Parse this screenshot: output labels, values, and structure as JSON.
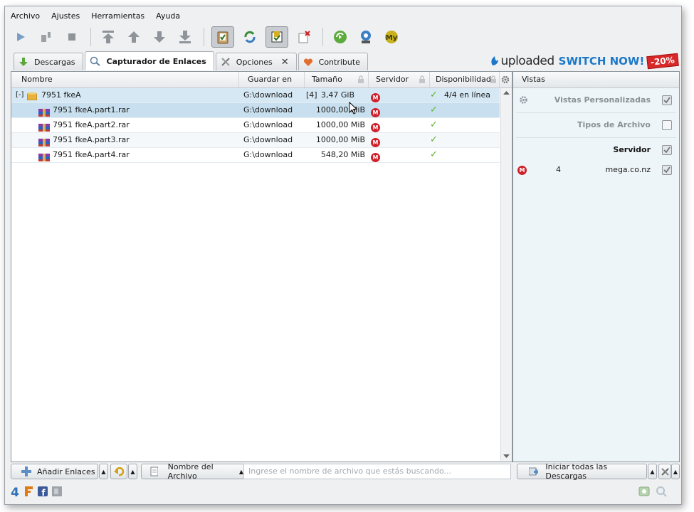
{
  "menu": [
    "Archivo",
    "Ajustes",
    "Herramientas",
    "Ayuda"
  ],
  "tabs": [
    {
      "label": "Descargas"
    },
    {
      "label": "Capturador de Enlaces"
    },
    {
      "label": "Opciones"
    },
    {
      "label": "Contribute"
    }
  ],
  "ad": {
    "brand": "uploaded",
    "cta": "SWITCH NOW!",
    "discount": "-20%"
  },
  "columns": {
    "name": "Nombre",
    "save_to": "Guardar en",
    "size": "Tamaño",
    "host": "Servidor",
    "availability": "Disponibilidad"
  },
  "package": {
    "expander": "[-]",
    "name": "7951 fkeA",
    "save_to": "G:\\download",
    "count": "[4]",
    "size": "3,47 GiB",
    "availability": "4/4 en línea"
  },
  "files": [
    {
      "name": "7951 fkeA.part1.rar",
      "save_to": "G:\\download",
      "size": "1000,00 MiB"
    },
    {
      "name": "7951 fkeA.part2.rar",
      "save_to": "G:\\download",
      "size": "1000,00 MiB"
    },
    {
      "name": "7951 fkeA.part3.rar",
      "save_to": "G:\\download",
      "size": "1000,00 MiB"
    },
    {
      "name": "7951 fkeA.part4.rar",
      "save_to": "G:\\download",
      "size": "548,20 MiB"
    }
  ],
  "host_badge": "M",
  "views": {
    "title": "Vistas",
    "custom": "Vistas Personalizadas",
    "file_types": "Tipos de Archivo",
    "host": "Servidor",
    "host_entry": {
      "count": "4",
      "name": "mega.co.nz"
    }
  },
  "bottom": {
    "add_links": "Añadir Enlaces",
    "filename_filter": "Nombre del Archivo",
    "search_placeholder": "Ingrese el nombre de archivo que estás buscando...",
    "start_all": "Iniciar todas las Descargas"
  },
  "colors": {
    "accent": "#1e78c8",
    "mega_red": "#d0202a",
    "online_green": "#5fb42c",
    "selection": "#c7dfee"
  }
}
